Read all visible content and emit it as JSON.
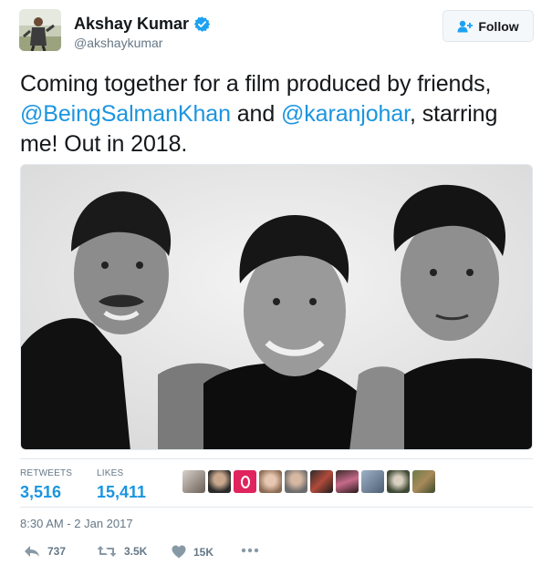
{
  "header": {
    "display_name": "Akshay Kumar",
    "handle": "@akshaykumar",
    "follow_label": "Follow"
  },
  "tweet": {
    "text_part1": "Coming together for a film produced by friends, ",
    "mention1": "@BeingSalmanKhan",
    "text_part2": " and ",
    "mention2": "@karanjohar",
    "text_part3": ", starring me! Out in 2018."
  },
  "stats": {
    "retweets_label": "RETWEETS",
    "retweets_value": "3,516",
    "likes_label": "LIKES",
    "likes_value": "15,411"
  },
  "timestamp": "8:30 AM - 2 Jan 2017",
  "actions": {
    "reply_count": "737",
    "retweet_count": "3.5K",
    "like_count": "15K"
  },
  "colors": {
    "link": "#1b95e0",
    "muted": "#657786",
    "verified": "#1da1f2"
  },
  "icons": [
    "verified-badge-icon",
    "follow-person-icon",
    "reply-icon",
    "retweet-icon",
    "like-heart-icon",
    "more-dots-icon"
  ]
}
